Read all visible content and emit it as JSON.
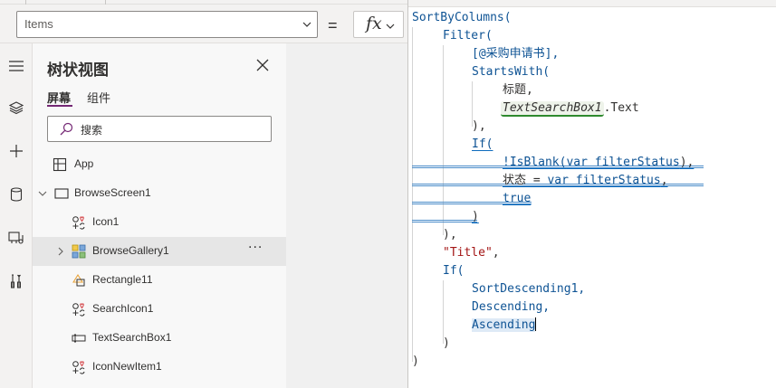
{
  "formula_bar": {
    "property_value": "Items",
    "equals": "=",
    "fx_label": "fx"
  },
  "rail": {
    "icons": [
      "hamburger-icon",
      "layers-icon",
      "plus-icon",
      "database-icon",
      "media-icon",
      "tools-icon"
    ]
  },
  "tree": {
    "title": "树状视图",
    "tabs": [
      {
        "label": "屏幕",
        "active": true
      },
      {
        "label": "组件",
        "active": false
      }
    ],
    "search_placeholder": "搜索",
    "nodes": [
      {
        "label": "App",
        "icon": "app-icon",
        "level": 0,
        "expander": "none"
      },
      {
        "label": "BrowseScreen1",
        "icon": "screen-icon",
        "level": 0,
        "expander": "expanded"
      },
      {
        "label": "Icon1",
        "icon": "icon-control-icon",
        "level": 1,
        "expander": "none"
      },
      {
        "label": "BrowseGallery1",
        "icon": "gallery-icon",
        "level": 1,
        "expander": "collapsed",
        "selected": true,
        "more": "···"
      },
      {
        "label": "Rectangle11",
        "icon": "shape-icon",
        "level": 1,
        "expander": "none"
      },
      {
        "label": "SearchIcon1",
        "icon": "icon-control-icon",
        "level": 1,
        "expander": "none"
      },
      {
        "label": "TextSearchBox1",
        "icon": "textinput-icon",
        "level": 1,
        "expander": "none"
      },
      {
        "label": "IconNewItem1",
        "icon": "icon-control-icon",
        "level": 1,
        "expander": "none"
      }
    ]
  },
  "code": {
    "l1": "SortByColumns(",
    "l2": "Filter(",
    "l3": "[@采购申请书],",
    "l4": "StartsWith(",
    "l5": "标题,",
    "l6_ctl": "TextSearchBox1",
    "l6_prop": ".Text",
    "l7": "),",
    "l8": "If(",
    "l9a": "!IsBlank(",
    "l9b": "var filterStatus",
    "l9c": "),",
    "l10a": "状态 = ",
    "l10b": "var filterStatus",
    "l10c": ",",
    "l11": "true",
    "l12": ")",
    "l13": "),",
    "l14a": "\"Title\"",
    "l14b": ",",
    "l15": "If(",
    "l16": "SortDescending1,",
    "l17": "Descending,",
    "l18": "Ascending",
    "l19": ")",
    "l20": ")"
  }
}
